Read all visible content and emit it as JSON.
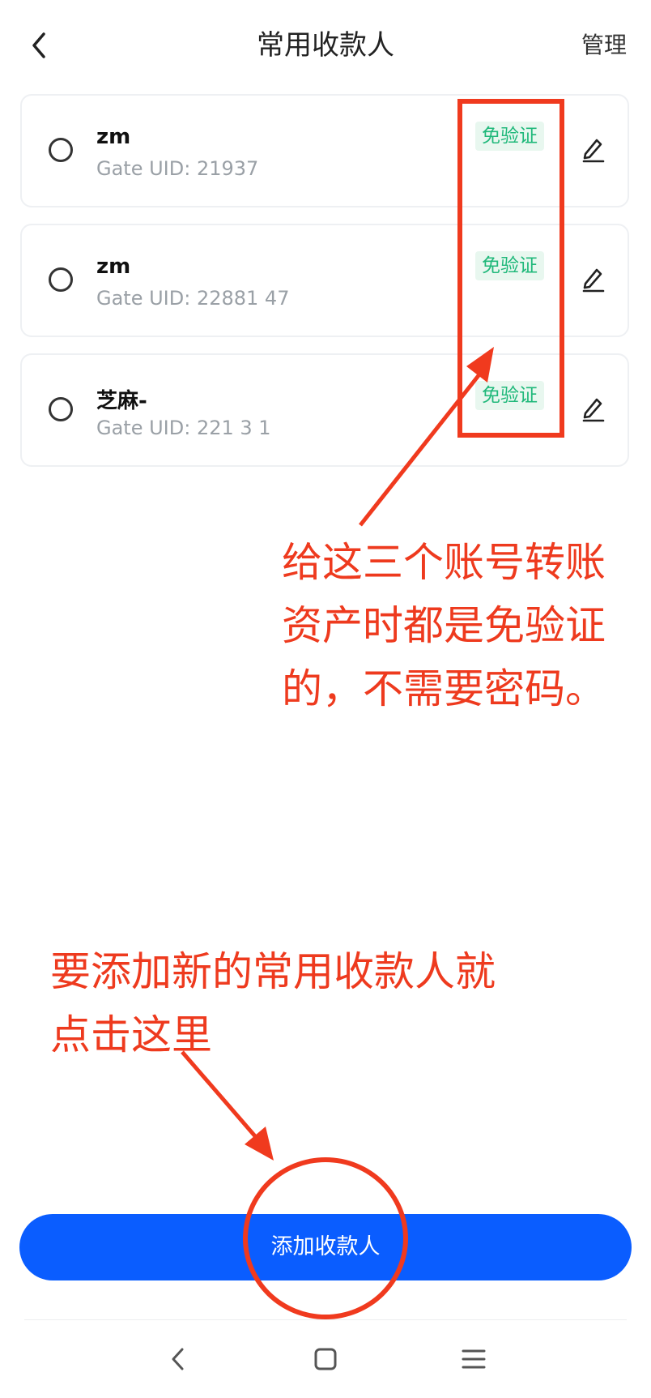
{
  "header": {
    "title": "常用收款人",
    "manage_label": "管理"
  },
  "payees": [
    {
      "name": "zm",
      "uid": "Gate UID: 21937",
      "badge": "免验证"
    },
    {
      "name": "zm",
      "uid": "Gate UID: 22881 47",
      "badge": "免验证"
    },
    {
      "name": "芝麻-",
      "uid": "Gate UID: 221 3 1",
      "badge": "免验证"
    }
  ],
  "annotations": {
    "note1_line1": "给这三个账号转账",
    "note1_line2": "资产时都是免验证",
    "note1_line3": "的，不需要密码。",
    "note2_line1": "要添加新的常用收款人就",
    "note2_line2": "点击这里"
  },
  "add_button_label": "添加收款人",
  "colors": {
    "primary_blue": "#0a5dff",
    "badge_green": "#1fb87a",
    "annotation_red": "#ee3a1e"
  },
  "icons": {
    "back": "chevron-left-icon",
    "edit": "pencil-icon",
    "nav_back": "nav-back-icon",
    "nav_home": "nav-home-icon",
    "nav_menu": "nav-menu-icon"
  }
}
